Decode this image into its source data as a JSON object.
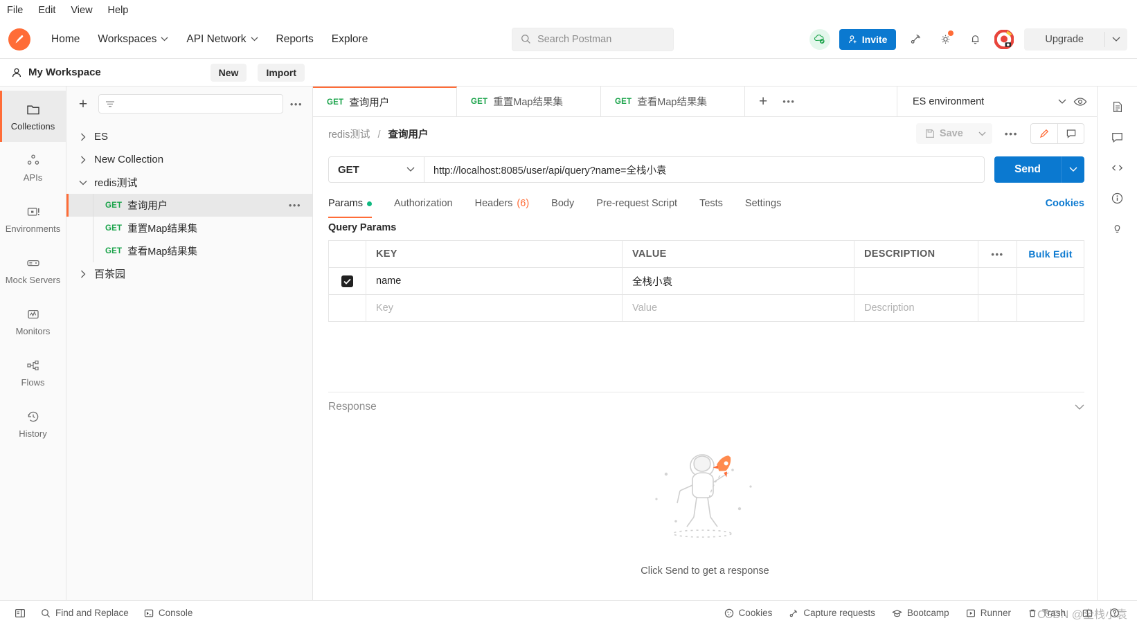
{
  "menubar": {
    "items": [
      "File",
      "Edit",
      "View",
      "Help"
    ]
  },
  "header": {
    "logo_icon": "postman-logo-icon",
    "nav": [
      {
        "label": "Home",
        "has_caret": false
      },
      {
        "label": "Workspaces",
        "has_caret": true
      },
      {
        "label": "API Network",
        "has_caret": true
      },
      {
        "label": "Reports",
        "has_caret": false
      },
      {
        "label": "Explore",
        "has_caret": false
      }
    ],
    "search": {
      "placeholder": "Search Postman",
      "icon": "search-icon"
    },
    "sync_icon": "cloud-sync-ok-icon",
    "invite_label": "Invite",
    "invite_icon": "user-plus-icon",
    "satellite_icon": "satellite-icon",
    "settings_icon": "gear-icon",
    "notifications_icon": "bell-icon",
    "avatar_icon": "user-avatar",
    "upgrade_label": "Upgrade",
    "upgrade_caret_icon": "chevron-down-icon",
    "accent_color": "#ff6c37",
    "primary_color": "#0b79d0"
  },
  "workspace": {
    "icon": "user-icon",
    "title": "My Workspace",
    "new_label": "New",
    "import_label": "Import"
  },
  "rail": {
    "items": [
      {
        "label": "Collections",
        "icon": "collections-icon",
        "active": true
      },
      {
        "label": "APIs",
        "icon": "apis-icon",
        "active": false
      },
      {
        "label": "Environments",
        "icon": "environments-icon",
        "active": false
      },
      {
        "label": "Mock Servers",
        "icon": "mock-servers-icon",
        "active": false
      },
      {
        "label": "Monitors",
        "icon": "monitors-icon",
        "active": false
      },
      {
        "label": "Flows",
        "icon": "flows-icon",
        "active": false
      },
      {
        "label": "History",
        "icon": "history-icon",
        "active": false
      }
    ]
  },
  "collections": {
    "add_icon": "plus-icon",
    "filter_icon": "filter-icon",
    "filter_placeholder": "",
    "more_icon": "more-options-icon",
    "tree": [
      {
        "type": "collection",
        "label": "ES",
        "expanded": false
      },
      {
        "type": "collection",
        "label": "New Collection",
        "expanded": false
      },
      {
        "type": "collection",
        "label": "redis测试",
        "expanded": true
      },
      {
        "type": "request",
        "method": "GET",
        "label": "查询用户",
        "selected": true
      },
      {
        "type": "request",
        "method": "GET",
        "label": "重置Map结果集",
        "selected": false
      },
      {
        "type": "request",
        "method": "GET",
        "label": "查看Map结果集",
        "selected": false
      },
      {
        "type": "collection",
        "label": "百茶园",
        "expanded": false
      }
    ]
  },
  "tabs": {
    "open": [
      {
        "method": "GET",
        "label": "查询用户",
        "active": true
      },
      {
        "method": "GET",
        "label": "重置Map结果集",
        "active": false
      },
      {
        "method": "GET",
        "label": "查看Map结果集",
        "active": false
      }
    ],
    "new_tab_icon": "plus-icon",
    "more_icon": "more-options-icon",
    "environment": "ES environment",
    "environment_caret_icon": "chevron-down-icon",
    "eye_icon": "eye-icon"
  },
  "request": {
    "breadcrumb_collection": "redis测试",
    "breadcrumb_separator": "/",
    "breadcrumb_name": "查询用户",
    "save_label": "Save",
    "save_icon": "save-disk-icon",
    "save_caret_icon": "chevron-down-icon",
    "more_icon": "more-options-icon",
    "edit_icon": "pencil-icon",
    "comment_icon": "comment-icon",
    "method": "GET",
    "method_caret_icon": "chevron-down-icon",
    "url": "http://localhost:8085/user/api/query?name=全栈小袁",
    "send_label": "Send",
    "send_caret_icon": "chevron-down-icon",
    "tabs": [
      {
        "label": "Params",
        "active": true,
        "dot": true
      },
      {
        "label": "Authorization",
        "active": false
      },
      {
        "label": "Headers",
        "active": false,
        "count": "(6)"
      },
      {
        "label": "Body",
        "active": false
      },
      {
        "label": "Pre-request Script",
        "active": false
      },
      {
        "label": "Tests",
        "active": false
      },
      {
        "label": "Settings",
        "active": false
      }
    ],
    "cookies_link": "Cookies"
  },
  "params": {
    "section_title": "Query Params",
    "columns": [
      "KEY",
      "VALUE",
      "DESCRIPTION"
    ],
    "more_icon": "more-options-icon",
    "bulk_edit_label": "Bulk Edit",
    "rows": [
      {
        "checked": true,
        "key": "name",
        "value": "全栈小袁",
        "description": ""
      }
    ],
    "placeholder_row": {
      "key": "Key",
      "value": "Value",
      "description": "Description"
    }
  },
  "response": {
    "title": "Response",
    "collapse_icon": "chevron-down-icon",
    "empty_message": "Click Send to get a response",
    "illustration": "astronaut-rocket-illustration"
  },
  "right_rail": {
    "items": [
      {
        "icon": "document-icon"
      },
      {
        "icon": "comment-icon"
      },
      {
        "icon": "code-icon"
      },
      {
        "icon": "info-icon"
      },
      {
        "icon": "lightbulb-icon"
      }
    ]
  },
  "statusbar": {
    "left": [
      {
        "label": "",
        "icon": "sidebar-toggle-icon"
      },
      {
        "label": "Find and Replace",
        "icon": "search-icon"
      },
      {
        "label": "Console",
        "icon": "console-icon"
      }
    ],
    "right": [
      {
        "label": "Cookies",
        "icon": "cookie-icon"
      },
      {
        "label": "Capture requests",
        "icon": "satellite-icon"
      },
      {
        "label": "Bootcamp",
        "icon": "graduation-cap-icon"
      },
      {
        "label": "Runner",
        "icon": "play-box-icon"
      },
      {
        "label": "Trash",
        "icon": "trash-icon"
      },
      {
        "label": "",
        "icon": "layout-panes-icon"
      },
      {
        "label": "",
        "icon": "help-icon"
      }
    ],
    "watermark": "CSDN @全栈小袁"
  }
}
